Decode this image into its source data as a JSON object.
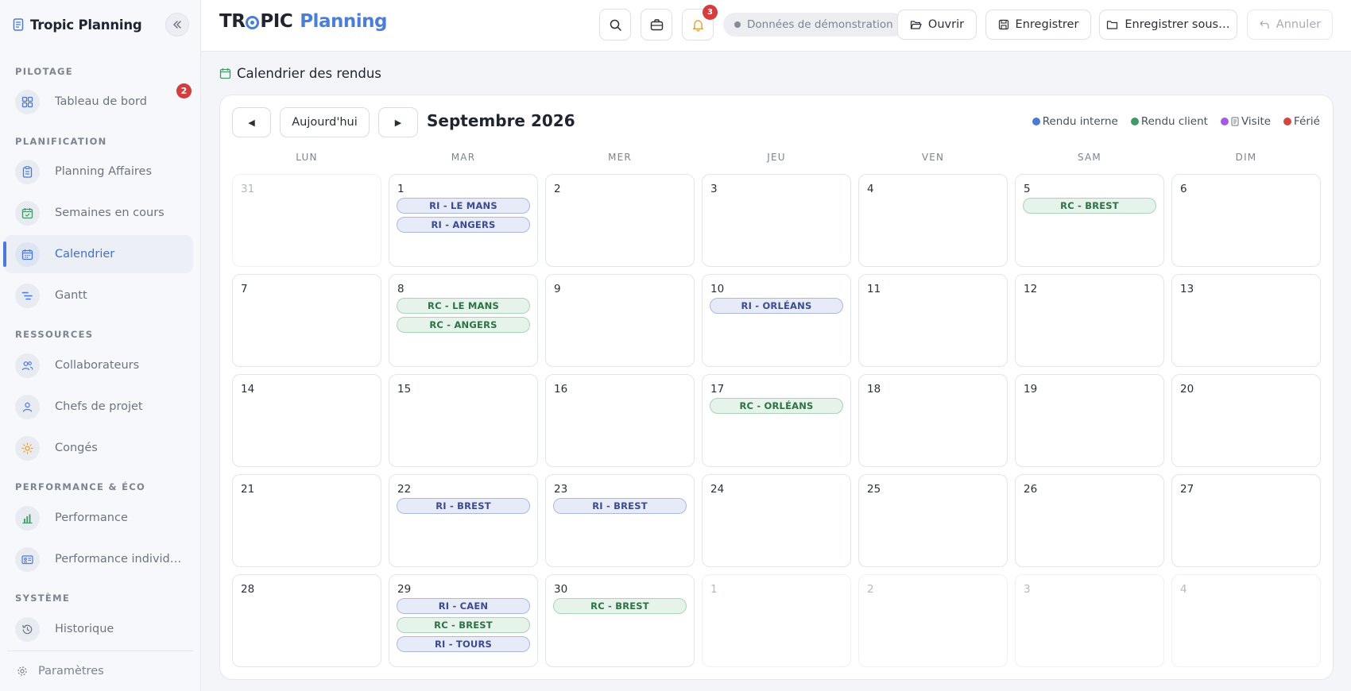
{
  "app": {
    "title": "Tropic Planning",
    "logo_part1": "TR",
    "logo_part1b": "PIC",
    "logo_part2": "Planning"
  },
  "sidebar": {
    "sections": [
      {
        "label": "PILOTAGE"
      },
      {
        "label": "PLANIFICATION"
      },
      {
        "label": "RESSOURCES"
      },
      {
        "label": "PERFORMANCE & ÉCO"
      },
      {
        "label": "SYSTÈME"
      }
    ],
    "items": [
      {
        "label": "Tableau de bord",
        "icon": "dashboard-icon",
        "badge": "2"
      },
      {
        "label": "Planning Affaires",
        "icon": "clipboard-icon"
      },
      {
        "label": "Semaines en cours",
        "icon": "calendar-check-icon"
      },
      {
        "label": "Calendrier",
        "icon": "calendar-icon",
        "active": true
      },
      {
        "label": "Gantt",
        "icon": "gantt-icon"
      },
      {
        "label": "Collaborateurs",
        "icon": "users-icon"
      },
      {
        "label": "Chefs de projet",
        "icon": "user-icon"
      },
      {
        "label": "Congés",
        "icon": "sun-icon"
      },
      {
        "label": "Performance",
        "icon": "bar-chart-icon"
      },
      {
        "label": "Performance individu…",
        "icon": "id-card-icon"
      },
      {
        "label": "Historique",
        "icon": "history-icon"
      }
    ],
    "footer_label": "Paramètres"
  },
  "topbar": {
    "notifications_count": "3",
    "demo_label": "Données de démonstration",
    "open_label": "Ouvrir",
    "save_label": "Enregistrer",
    "save_as_label": "Enregistrer sous…",
    "undo_label": "Annuler"
  },
  "calendar": {
    "page_title": "Calendrier des rendus",
    "prev_label": "◀",
    "today_label": "Aujourd'hui",
    "next_label": "▶",
    "month_label": "Septembre 2026",
    "legend": [
      {
        "label": "Rendu interne",
        "color": "#4b79d8"
      },
      {
        "label": "Rendu client",
        "color": "#3f9a64"
      },
      {
        "label": "Visite",
        "color": "#a45be0"
      },
      {
        "label": "Férié",
        "color": "#d0483f"
      }
    ],
    "weekdays": [
      "LUN",
      "MAR",
      "MER",
      "JEU",
      "VEN",
      "SAM",
      "DIM"
    ],
    "days": [
      {
        "num": "31",
        "muted": true,
        "events": []
      },
      {
        "num": "1",
        "events": [
          {
            "label": "RI - LE MANS",
            "type": "ri"
          },
          {
            "label": "RI - ANGERS",
            "type": "ri"
          }
        ]
      },
      {
        "num": "2",
        "events": []
      },
      {
        "num": "3",
        "events": []
      },
      {
        "num": "4",
        "events": []
      },
      {
        "num": "5",
        "events": [
          {
            "label": "RC - BREST",
            "type": "rc"
          }
        ]
      },
      {
        "num": "6",
        "events": []
      },
      {
        "num": "7",
        "events": []
      },
      {
        "num": "8",
        "events": [
          {
            "label": "RC - LE MANS",
            "type": "rc"
          },
          {
            "label": "RC - ANGERS",
            "type": "rc"
          }
        ]
      },
      {
        "num": "9",
        "events": []
      },
      {
        "num": "10",
        "events": [
          {
            "label": "RI - ORLÉANS",
            "type": "ri"
          }
        ]
      },
      {
        "num": "11",
        "events": []
      },
      {
        "num": "12",
        "events": []
      },
      {
        "num": "13",
        "events": []
      },
      {
        "num": "14",
        "events": []
      },
      {
        "num": "15",
        "events": []
      },
      {
        "num": "16",
        "events": []
      },
      {
        "num": "17",
        "events": [
          {
            "label": "RC - ORLÉANS",
            "type": "rc"
          }
        ]
      },
      {
        "num": "18",
        "events": []
      },
      {
        "num": "19",
        "events": []
      },
      {
        "num": "20",
        "events": []
      },
      {
        "num": "21",
        "events": []
      },
      {
        "num": "22",
        "events": [
          {
            "label": "RI - BREST",
            "type": "ri"
          }
        ]
      },
      {
        "num": "23",
        "events": [
          {
            "label": "RI - BREST",
            "type": "ri"
          }
        ]
      },
      {
        "num": "24",
        "events": []
      },
      {
        "num": "25",
        "events": []
      },
      {
        "num": "26",
        "events": []
      },
      {
        "num": "27",
        "events": []
      },
      {
        "num": "28",
        "events": []
      },
      {
        "num": "29",
        "events": [
          {
            "label": "RI - CAEN",
            "type": "ri"
          },
          {
            "label": "RC - BREST",
            "type": "rc"
          },
          {
            "label": "RI - TOURS",
            "type": "ri"
          }
        ]
      },
      {
        "num": "30",
        "events": [
          {
            "label": "RC - BREST",
            "type": "rc"
          }
        ]
      },
      {
        "num": "1",
        "muted": true,
        "events": []
      },
      {
        "num": "2",
        "muted": true,
        "events": []
      },
      {
        "num": "3",
        "muted": true,
        "events": []
      },
      {
        "num": "4",
        "muted": true,
        "events": []
      }
    ]
  }
}
